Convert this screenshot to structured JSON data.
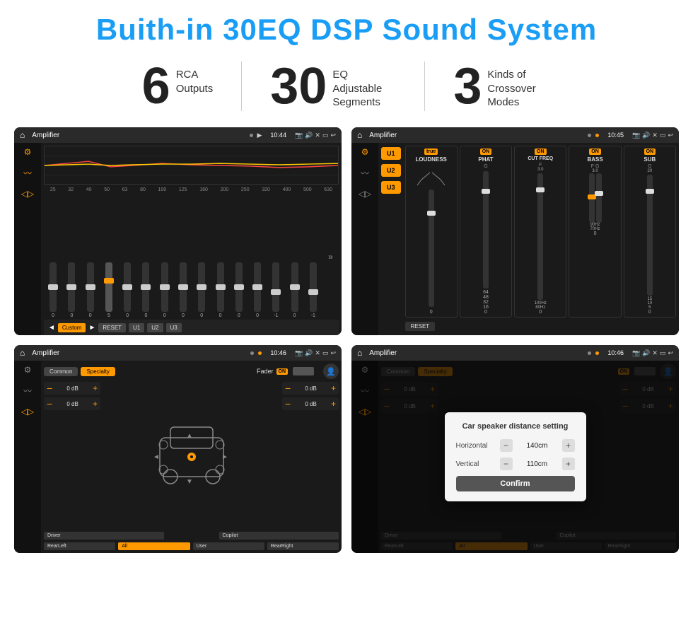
{
  "header": {
    "title": "Buith-in 30EQ DSP Sound System"
  },
  "stats": [
    {
      "number": "6",
      "text_line1": "RCA",
      "text_line2": "Outputs"
    },
    {
      "number": "30",
      "text_line1": "EQ Adjustable",
      "text_line2": "Segments"
    },
    {
      "number": "3",
      "text_line1": "Kinds of",
      "text_line2": "Crossover Modes"
    }
  ],
  "screens": [
    {
      "id": "screen1",
      "status_app": "Amplifier",
      "status_time": "10:44",
      "eq_freqs": [
        "25",
        "32",
        "40",
        "50",
        "63",
        "80",
        "100",
        "125",
        "160",
        "200",
        "250",
        "320",
        "400",
        "500",
        "630"
      ],
      "eq_values": [
        "0",
        "0",
        "0",
        "5",
        "0",
        "0",
        "0",
        "0",
        "0",
        "0",
        "0",
        "0",
        "-1",
        "0",
        "-1"
      ],
      "eq_sliders_pos": [
        50,
        50,
        50,
        35,
        50,
        50,
        50,
        50,
        50,
        50,
        50,
        50,
        60,
        50,
        60
      ],
      "bottom_btns": [
        "Custom",
        "RESET",
        "U1",
        "U2",
        "U3"
      ]
    },
    {
      "id": "screen2",
      "status_app": "Amplifier",
      "status_time": "10:45",
      "u_buttons": [
        "U1",
        "U2",
        "U3"
      ],
      "channels": [
        {
          "label": "LOUDNESS",
          "on": true,
          "val_top": "",
          "val_bot": "0"
        },
        {
          "label": "PHAT",
          "on": true,
          "val_top": "G",
          "val_bot": "0"
        },
        {
          "label": "CUT FREQ",
          "on": true,
          "val_top": "F",
          "val_bot": "0"
        },
        {
          "label": "BASS",
          "on": true,
          "val_top": "F G",
          "val_bot": "0"
        },
        {
          "label": "SUB",
          "on": true,
          "val_top": "G",
          "val_bot": "0"
        }
      ],
      "reset_label": "RESET"
    },
    {
      "id": "screen3",
      "status_app": "Amplifier",
      "status_time": "10:46",
      "tabs": [
        "Common",
        "Specialty"
      ],
      "fader_label": "Fader",
      "fader_on": "ON",
      "zones": [
        {
          "label": "Driver",
          "active": false
        },
        {
          "label": "All",
          "active": true
        },
        {
          "label": "Copilot",
          "active": false
        },
        {
          "label": "RearLeft",
          "active": false
        },
        {
          "label": "User",
          "active": false
        },
        {
          "label": "RearRight",
          "active": false
        }
      ],
      "db_values": [
        "0 dB",
        "0 dB",
        "0 dB",
        "0 dB"
      ]
    },
    {
      "id": "screen4",
      "status_app": "Amplifier",
      "status_time": "10:46",
      "tabs": [
        "Common",
        "Specialty"
      ],
      "fader_on": "ON",
      "dialog": {
        "title": "Car speaker distance setting",
        "rows": [
          {
            "label": "Horizontal",
            "value": "140cm"
          },
          {
            "label": "Vertical",
            "value": "110cm"
          }
        ],
        "confirm_label": "Confirm"
      },
      "db_values_right": [
        "0 dB",
        "0 dB"
      ],
      "zones_bottom": [
        "RearLeft",
        "All",
        "User",
        "RearRight"
      ]
    }
  ]
}
